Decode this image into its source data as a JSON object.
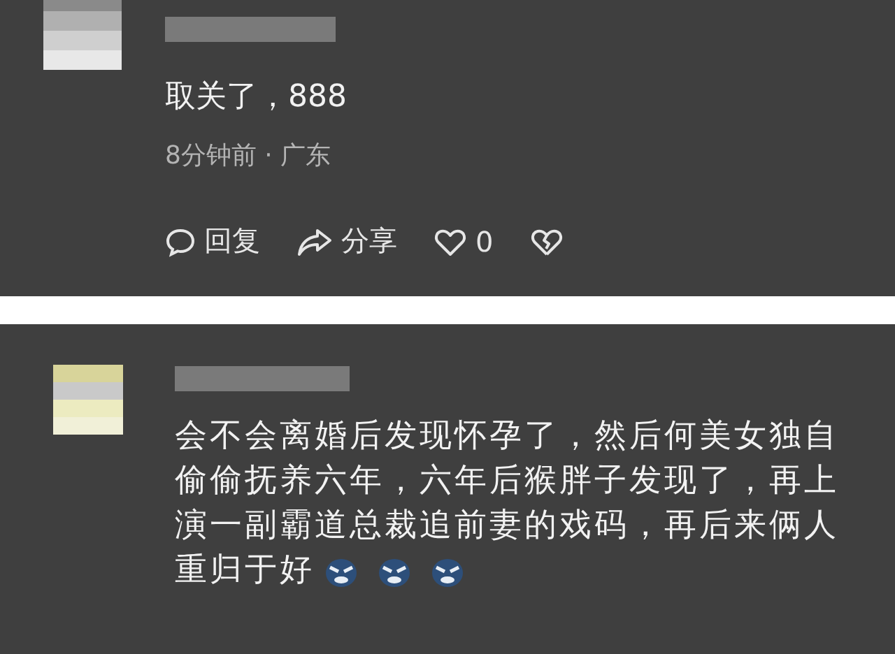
{
  "comments": [
    {
      "kind": "full",
      "text": "取关了，888",
      "meta": "8分钟前 · 广东",
      "actions": {
        "reply": "回复",
        "share": "分享",
        "likes": "0"
      }
    },
    {
      "kind": "partial",
      "text": "会不会离婚后发现怀孕了，然后何美女独自偷偷抚养六年，六年后猴胖子发现了，再上演一副霸道总裁追前妻的戏码，再后来俩人重归于好",
      "icons": [
        {
          "kind": "emoji"
        },
        {
          "kind": "emoji"
        },
        {
          "kind": "emoji"
        }
      ]
    }
  ]
}
